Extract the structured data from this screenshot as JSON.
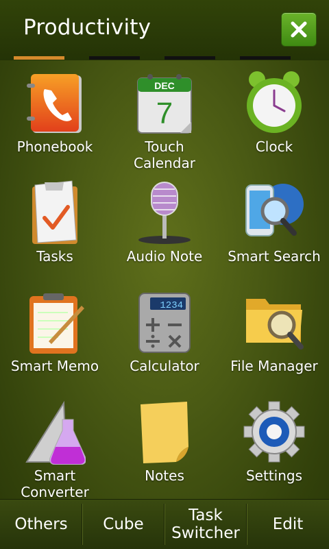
{
  "header": {
    "title": "Productivity"
  },
  "page_indicator": {
    "count": 4,
    "active": 1
  },
  "apps": [
    {
      "label": "Phonebook",
      "icon": "phonebook-icon"
    },
    {
      "label": "Touch\nCalendar",
      "icon": "calendar-icon",
      "calendar_month": "DEC",
      "calendar_day": "7"
    },
    {
      "label": "Clock",
      "icon": "alarm-clock-icon"
    },
    {
      "label": "Tasks",
      "icon": "tasks-clipboard-icon"
    },
    {
      "label": "Audio Note",
      "icon": "microphone-icon"
    },
    {
      "label": "Smart Search",
      "icon": "search-globe-icon"
    },
    {
      "label": "Smart Memo",
      "icon": "memo-icon"
    },
    {
      "label": "Calculator",
      "icon": "calculator-icon",
      "display": "1234"
    },
    {
      "label": "File Manager",
      "icon": "folder-search-icon"
    },
    {
      "label": "Smart\nConverter",
      "icon": "converter-flask-icon"
    },
    {
      "label": "Notes",
      "icon": "sticky-note-icon"
    },
    {
      "label": "Settings",
      "icon": "gear-icon"
    }
  ],
  "bottom_bar": {
    "others": "Others",
    "cube": "Cube",
    "task_switcher": "Task\nSwitcher",
    "edit": "Edit"
  },
  "colors": {
    "accent": "#d58a2c",
    "close_button": "#55a01e"
  }
}
